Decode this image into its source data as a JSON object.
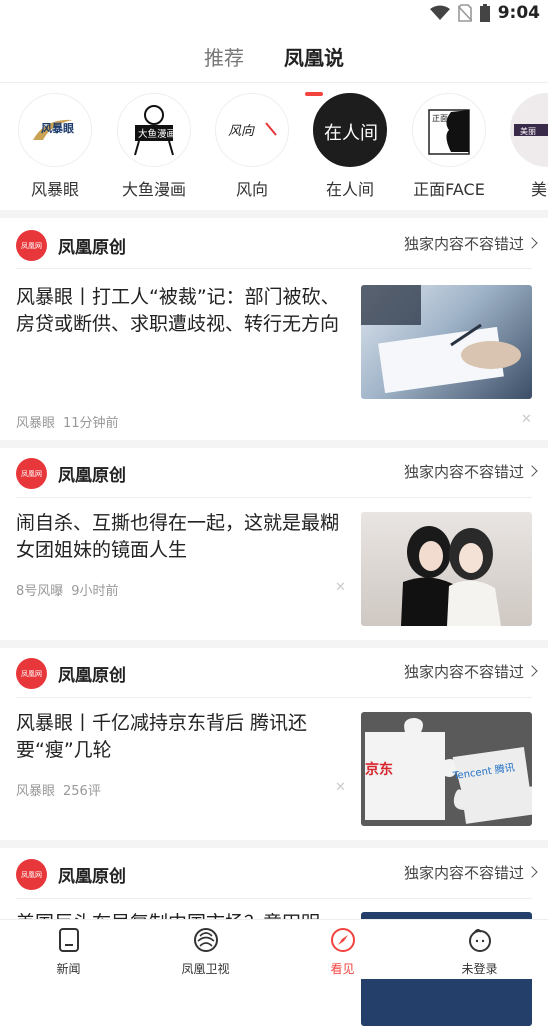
{
  "status_bar": {
    "time": "9:04",
    "icons": [
      "wifi-icon",
      "no-sim-icon",
      "battery-icon"
    ]
  },
  "tabs": [
    {
      "label": "推荐",
      "active": false
    },
    {
      "label": "凤凰说",
      "active": true
    }
  ],
  "channels": [
    {
      "name": "风暴眼",
      "logo_text": "风暴眼"
    },
    {
      "name": "大鱼漫画",
      "logo_text": "大鱼漫画"
    },
    {
      "name": "风向",
      "logo_text": "风向"
    },
    {
      "name": "在人间",
      "logo_text": "在人间"
    },
    {
      "name": "正面FACE",
      "logo_text": "正面"
    },
    {
      "name": "美丽",
      "logo_text": "美丽"
    }
  ],
  "cards": [
    {
      "source": "凤凰原创",
      "more": "独家内容不容错过",
      "title": "风暴眼丨打工人“被裁”记：部门被砍、房贷或断供、求职遭歧视、转行无方向",
      "author": "风暴眼",
      "time": "11分钟前"
    },
    {
      "source": "凤凰原创",
      "more": "独家内容不容错过",
      "title": "闹自杀、互撕也得在一起，这就是最糊女团姐妹的镜面人生",
      "author": "8号风曝",
      "time": "9小时前"
    },
    {
      "source": "凤凰原创",
      "more": "独家内容不容错过",
      "title": "风暴眼丨千亿减持京东背后 腾讯还要“瘦”几轮",
      "author": "风暴眼",
      "time": "256评"
    },
    {
      "source": "凤凰原创",
      "more": "独家内容不容错过",
      "title": "美国巨头布局复制中国市场？意田明",
      "author": "",
      "time": ""
    }
  ],
  "thumb_text": {
    "jd": "京东",
    "tencent": "Tencent 腾讯"
  },
  "bottom_nav": [
    {
      "label": "新闻",
      "icon": "news-icon",
      "active": false
    },
    {
      "label": "凤凰卫视",
      "icon": "phoenix-icon",
      "active": false
    },
    {
      "label": "看见",
      "icon": "compass-icon",
      "active": true
    },
    {
      "label": "未登录",
      "icon": "user-icon",
      "active": false
    }
  ],
  "colors": {
    "accent": "#f2433e"
  }
}
